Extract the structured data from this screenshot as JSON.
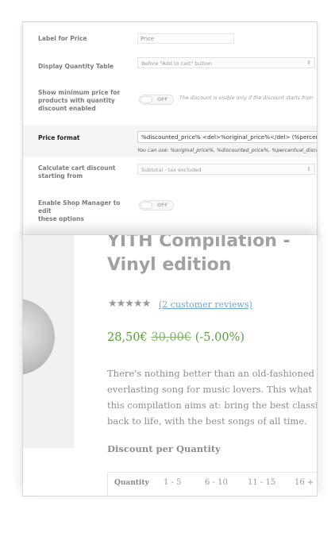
{
  "settings": {
    "label_for_price": {
      "label": "Label for Price",
      "value": "Price"
    },
    "display_quantity_table": {
      "label": "Display Quantity Table",
      "value": "Before \"Add to cart\" button",
      "caret": "⇕"
    },
    "show_minimum_price": {
      "label_lines": [
        "Show minimum price for",
        "products with quantity",
        "discount enabled"
      ],
      "toggle": "OFF",
      "hint": "The discount is visible only if the discount starts from"
    },
    "price_format": {
      "label": "Price format",
      "value": "%discounted_price% <del>%original_price%</del> (%percentual_discount%)",
      "hint": "You can use: %original_price%, %discounted_price%, %percentual_discount%"
    },
    "calculate_cart_discount": {
      "label_lines": [
        "Calculate cart discount",
        "starting from"
      ],
      "value": "Subtotal - tax excluded",
      "caret": "⇕"
    },
    "enable_shop_manager": {
      "label_lines": [
        "Enable Shop Manager to edit",
        "these options"
      ],
      "toggle": "OFF"
    }
  },
  "product": {
    "title_lines": [
      "YITH Compilation -",
      "Vinyl edition"
    ],
    "stars": "★★★★★",
    "reviews_link": "(2 customer reviews)",
    "price_new": "28,50€",
    "price_old": "30,00€",
    "price_pct": "(-5.00%)",
    "description_lines": [
      "There's nothing better than an old-fashioned",
      "everlasting song for music lovers. This what",
      "this compilation aims at: bring the best classic",
      "back to life, with the best songs of all time."
    ],
    "discount_title": "Discount per Quantity",
    "quantity_table": {
      "header": "Quantity",
      "ranges": [
        "1 - 5",
        "6 - 10",
        "11 - 15",
        "16 +"
      ]
    }
  },
  "colors": {
    "price_green": "#5a9a3c",
    "link_blue": "#6fa7cf",
    "title_gray": "#a1a1a1"
  }
}
